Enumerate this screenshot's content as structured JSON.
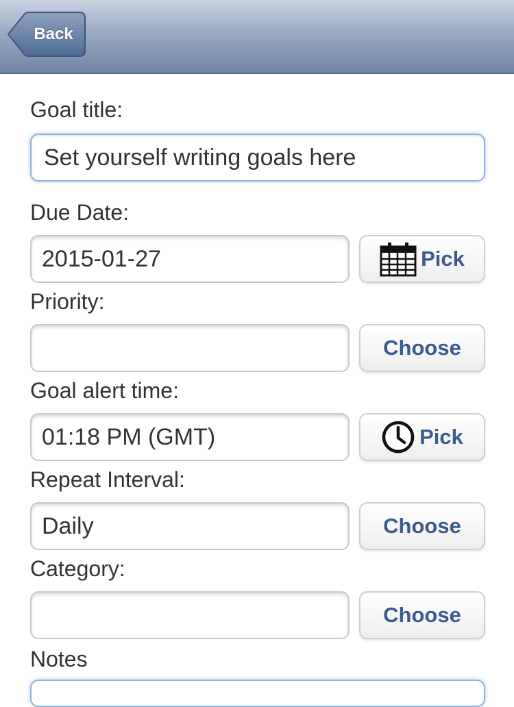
{
  "navbar": {
    "back_label": "Back"
  },
  "form": {
    "goal_title": {
      "label": "Goal title:",
      "value": "Set yourself writing goals here"
    },
    "due_date": {
      "label": "Due Date:",
      "value": "2015-01-27",
      "button": "Pick",
      "icon": "calendar-icon"
    },
    "priority": {
      "label": "Priority:",
      "value": "",
      "button": "Choose"
    },
    "alert_time": {
      "label": "Goal alert time:",
      "value": "01:18 PM (GMT)",
      "button": "Pick",
      "icon": "clock-icon"
    },
    "repeat_interval": {
      "label": "Repeat Interval:",
      "value": "Daily",
      "button": "Choose"
    },
    "category": {
      "label": "Category:",
      "value": "",
      "button": "Choose"
    },
    "notes": {
      "label": "Notes",
      "value": ""
    }
  },
  "colors": {
    "button_text": "#3c5a8f",
    "navbar": "#8a9cb7",
    "focus_border": "#8fb2da"
  }
}
